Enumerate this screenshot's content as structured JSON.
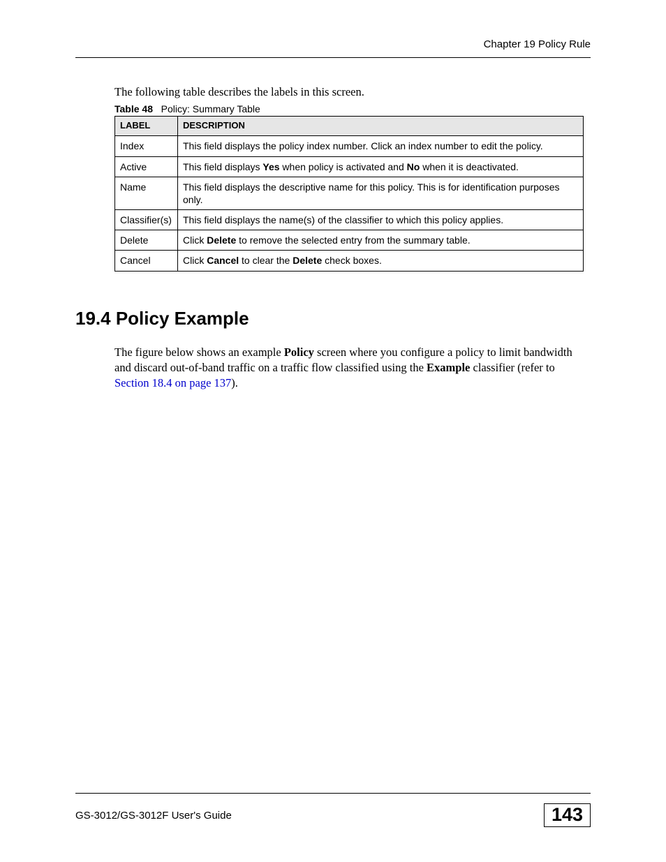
{
  "header": {
    "chapter": "Chapter 19 Policy Rule"
  },
  "intro": "The following table describes the labels in this screen.",
  "table": {
    "caption_num": "Table 48",
    "caption_title": "Policy: Summary Table",
    "headers": {
      "col1": "LABEL",
      "col2": "DESCRIPTION"
    },
    "rows": {
      "r0": {
        "label": "Index",
        "desc_pre": "This field displays the policy index number. Click an index number to edit the policy."
      },
      "r1": {
        "label": "Active",
        "p1": "This field displays ",
        "b1": "Yes",
        "p2": " when policy is activated and ",
        "b2": "No",
        "p3": " when it is deactivated."
      },
      "r2": {
        "label": "Name",
        "desc_pre": "This field displays the descriptive name for this policy. This is for identification purposes only."
      },
      "r3": {
        "label": "Classifier(s)",
        "desc_pre": "This field displays the name(s) of the classifier to which this policy applies."
      },
      "r4": {
        "label": "Delete",
        "p1": "Click ",
        "b1": "Delete",
        "p2": " to remove the selected entry from the summary table."
      },
      "r5": {
        "label": "Cancel",
        "p1": "Click ",
        "b1": "Cancel",
        "p2": " to clear the ",
        "b2": "Delete",
        "p3": " check boxes."
      }
    }
  },
  "section": {
    "heading": "19.4  Policy Example",
    "p1": "The figure below shows an example ",
    "b1": "Policy",
    "p2": " screen where you configure a policy to limit bandwidth and discard out-of-band traffic on a traffic flow classified using the ",
    "b2": "Example",
    "p3": " classifier (refer to ",
    "xref": "Section 18.4 on page 137",
    "p4": ")."
  },
  "footer": {
    "left": "GS-3012/GS-3012F User's Guide",
    "right": "143"
  }
}
